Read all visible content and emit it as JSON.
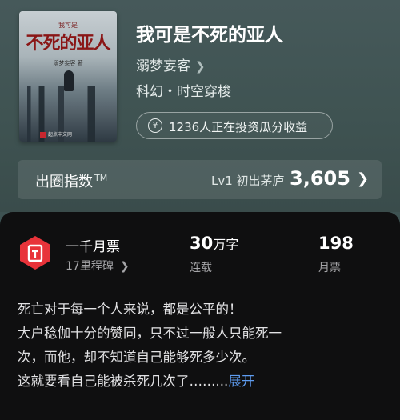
{
  "book": {
    "cover": {
      "small_text": "我可是",
      "title": "不死的亚人",
      "author": "溺梦妄客 著",
      "publisher": "起点中文网"
    },
    "title": "我可是不死的亚人",
    "author": "溺梦妄客",
    "genre": "科幻・时空穿梭",
    "invest_text": "1236人正在投资瓜分收益"
  },
  "index": {
    "label": "出圈指数",
    "tm": "TM",
    "level": "Lv1 初出茅庐",
    "value": "3,605"
  },
  "stats": {
    "tier_label": "一千月票",
    "tier_sub": "17里程碑",
    "words_num": "30",
    "words_unit": "万字",
    "words_status": "连载",
    "votes_num": "198",
    "votes_label": "月票"
  },
  "synopsis": {
    "lines": [
      "死亡对于每一个人来说，都是公平的！",
      "大户稔伽十分的赞同，只不过一般人只能死一",
      "次，而他，却不知道自己能够死多少次。",
      "这就要看自己能被杀死几次了……"
    ],
    "ellipsis": "...",
    "expand": "展开"
  },
  "colors": {
    "header_bg": "#3e5252",
    "card_bg": "#0f0f10",
    "badge_red": "#e8333a",
    "link_blue": "#5e9cf0"
  },
  "icons": [
    "chevron-right-icon",
    "coin-icon",
    "ticket-badge-icon"
  ]
}
